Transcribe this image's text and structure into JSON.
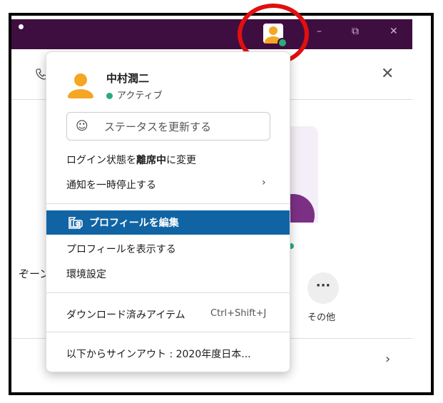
{
  "window": {
    "minimize_label": "–",
    "restore_label": "⧉",
    "close_label": "✕"
  },
  "background": {
    "phone_icon": "phone-icon",
    "close_label": "✕",
    "left_text": "ぞーン",
    "more_label": "···",
    "more_caption": "その他",
    "chevron_label": "›"
  },
  "menu": {
    "user": {
      "name": "中村潤二",
      "status": "アクティブ",
      "status_color": "#2bac76"
    },
    "status_input": {
      "placeholder": "ステータスを更新する",
      "icon": "smile-icon"
    },
    "items": {
      "set_away_prefix": "ログイン状態を",
      "set_away_bold": "離席中",
      "set_away_suffix": "に変更",
      "pause_notifications": "通知を一時停止する",
      "pause_chevron": "›",
      "edit_profile": "プロフィールを編集",
      "view_profile": "プロフィールを表示する",
      "preferences": "環境設定",
      "downloads": "ダウンロード済みアイテム",
      "downloads_shortcut": "Ctrl+Shift+J",
      "sign_out": "以下からサインアウト : 2020年度日本..."
    },
    "highlight_color": "#1164a3"
  },
  "colors": {
    "titlebar": "#3f0e40",
    "annotation": "#e01010",
    "avatar": "#f5a623"
  }
}
